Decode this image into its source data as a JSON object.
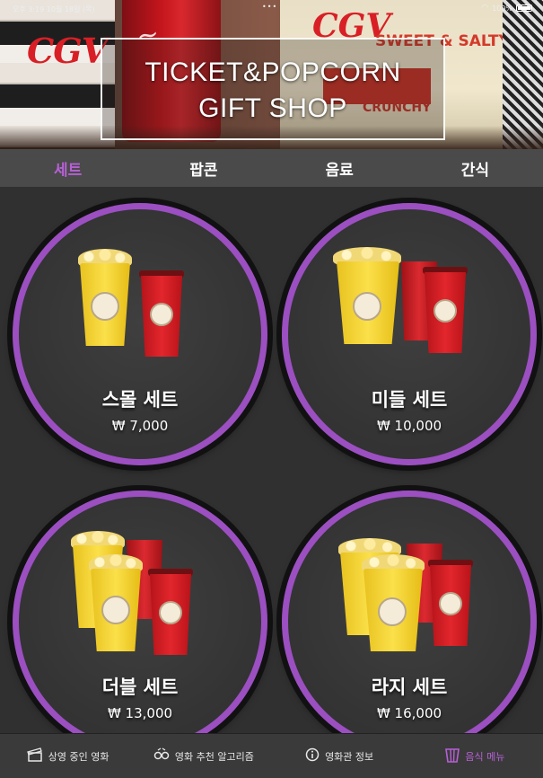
{
  "status_bar": {
    "time": "오후 3:19",
    "date": "10월 18일 (목)",
    "battery": "100%"
  },
  "banner": {
    "line1": "TICKET&POPCORN",
    "line2": "GIFT SHOP",
    "decor_texts": [
      "CGV",
      "CGV",
      "SWEET & SALTY",
      "CRUNCHY"
    ]
  },
  "tabs": [
    {
      "label": "세트",
      "active": true
    },
    {
      "label": "팝콘",
      "active": false
    },
    {
      "label": "음료",
      "active": false
    },
    {
      "label": "간식",
      "active": false
    }
  ],
  "products": [
    {
      "name": "스몰 세트",
      "price": "₩ 7,000"
    },
    {
      "name": "미들 세트",
      "price": "₩ 10,000"
    },
    {
      "name": "더블 세트",
      "price": "₩ 13,000"
    },
    {
      "name": "라지 세트",
      "price": "₩ 16,000"
    }
  ],
  "bottom_nav": [
    {
      "label": "상영 중인 영화",
      "icon": "clapperboard-icon",
      "active": false
    },
    {
      "label": "영화 추천 알고리즘",
      "icon": "recommend-icon",
      "active": false
    },
    {
      "label": "영화관 정보",
      "icon": "info-icon",
      "active": false
    },
    {
      "label": "음식 메뉴",
      "icon": "food-icon",
      "active": true
    }
  ],
  "colors": {
    "accent": "#b760d6",
    "ring": "#9b4fc1",
    "tab_bar": "#4a4a4a",
    "background": "#303030"
  }
}
